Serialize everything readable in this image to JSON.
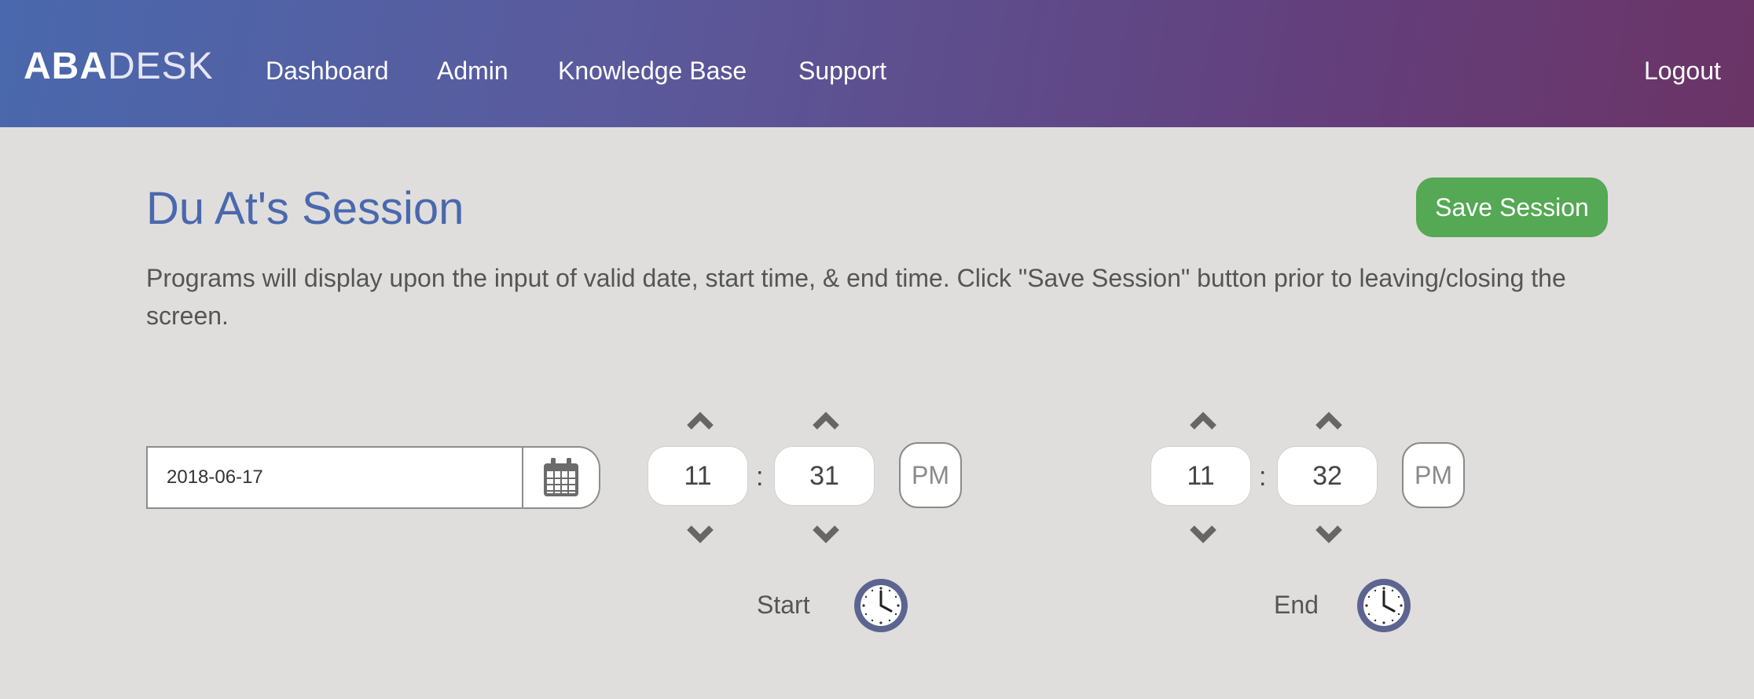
{
  "app": {
    "logo_bold": "ABA",
    "logo_light": "DESK"
  },
  "nav": {
    "items": [
      {
        "label": "Dashboard"
      },
      {
        "label": "Admin"
      },
      {
        "label": "Knowledge Base"
      },
      {
        "label": "Support"
      }
    ],
    "logout": "Logout"
  },
  "page": {
    "title": "Du At's Session",
    "save_label": "Save Session",
    "instructions": "Programs will display upon the input of valid date, start time, & end time. Click \"Save Session\" button prior to leaving/closing the screen."
  },
  "date": {
    "value": "2018-06-17",
    "icon": "calendar-icon"
  },
  "start": {
    "label": "Start",
    "hour": "11",
    "minute": "31",
    "meridiem": "PM",
    "separator": ":"
  },
  "end": {
    "label": "End",
    "hour": "11",
    "minute": "32",
    "meridiem": "PM",
    "separator": ":"
  },
  "colors": {
    "accent": "#4a68ad",
    "save": "#55a854",
    "header_start": "#4a68ad",
    "header_end": "#6b3466",
    "clock_ring": "#5c6590"
  }
}
